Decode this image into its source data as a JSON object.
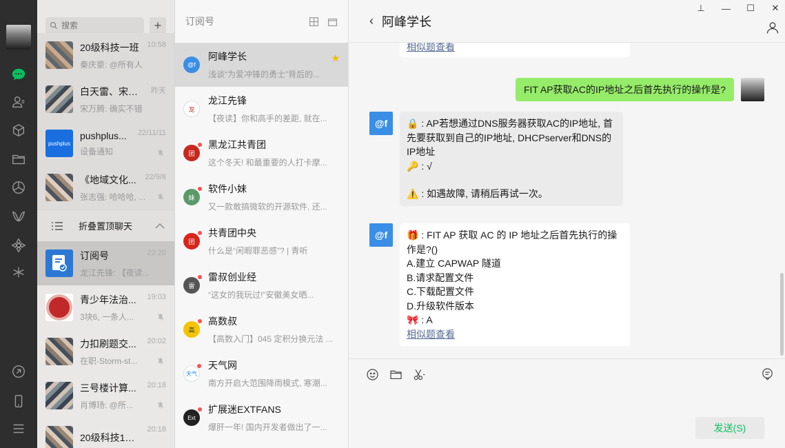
{
  "search": {
    "placeholder": "搜索"
  },
  "chats": [
    {
      "title": "20级科技一班",
      "sub": "秦庆豪: @所有人",
      "time": "10:58",
      "muted": false,
      "avatar_color": "#8b7b6a"
    },
    {
      "title": "白天雷、宋万...",
      "sub": "宋万腾: 确实不错",
      "time": "昨天",
      "muted": false,
      "avatar_color": "#7d8a8f"
    },
    {
      "title": "pushplus...",
      "sub": "设备通知",
      "time": "22/11/11",
      "muted": true,
      "avatar_color": "#1a6fe0"
    },
    {
      "title": "《地域文化...",
      "sub": "张志强: 哈哈哈, ...",
      "time": "22/9/8",
      "muted": true,
      "avatar_color": "#a08a7a"
    }
  ],
  "fold": {
    "label": "折叠置顶聊天"
  },
  "chats2": [
    {
      "title": "订阅号",
      "sub": "龙江先锋: 【夜读...",
      "time": "22:20",
      "muted": false,
      "avatar_color": "#2b78d4"
    },
    {
      "title": "青少年法治...",
      "sub": "3块6, 一条人...",
      "time": "19:03",
      "muted": true,
      "avatar_color": "#c0282a"
    },
    {
      "title": "力扣刷题交...",
      "sub": "在职-Storm-st...",
      "time": "20:02",
      "muted": true,
      "avatar_color": "#8a7c6f"
    },
    {
      "title": "三号楼计算...",
      "sub": "肖博玚: @所...",
      "time": "20:18",
      "muted": true,
      "avatar_color": "#7c8b91"
    },
    {
      "title": "20级科技1班...",
      "sub": "",
      "time": "20:18",
      "muted": false,
      "avatar_color": "#9a8574"
    }
  ],
  "pushplus_avatar_text": "pushplus",
  "sub_header": {
    "title": "订阅号"
  },
  "subs": [
    {
      "title": "阿峰学长",
      "sub": "浅谈“为爱冲锋的勇士”背后的...",
      "avatar_text": "@f",
      "avatar_color": "#3a8ee6",
      "starred": true,
      "dot": false
    },
    {
      "title": "龙江先锋",
      "sub": "【夜读】你和高手的差距, 就在...",
      "avatar_text": "龙",
      "avatar_color": "#b5322a",
      "starred": false,
      "dot": false
    },
    {
      "title": "黑龙江共青团",
      "sub": "这个冬天! 和最重要的人打卡摩...",
      "avatar_text": "团",
      "avatar_color": "#c8281e",
      "starred": false,
      "dot": true
    },
    {
      "title": "软件小妹",
      "sub": "又一款敢搞微软的开源软件, 还...",
      "avatar_text": "妹",
      "avatar_color": "#5a9a6a",
      "starred": false,
      "dot": true
    },
    {
      "title": "共青团中央",
      "sub": "什么是“闲暇罪恶感”? | 青听",
      "avatar_text": "团",
      "avatar_color": "#d9261c",
      "starred": false,
      "dot": true
    },
    {
      "title": "雷叔创业经",
      "sub": "“这女的我玩过!”安徽美女晒...",
      "avatar_text": "雷",
      "avatar_color": "#555555",
      "starred": false,
      "dot": true
    },
    {
      "title": "高数叔",
      "sub": "【高数入门】045 定积分换元法 ...",
      "avatar_text": "高",
      "avatar_color": "#f5c400",
      "starred": false,
      "dot": true
    },
    {
      "title": "天气网",
      "sub": "南方开启大范围降雨模式, 寒潮...",
      "avatar_text": "天气",
      "avatar_color": "#1e88e5",
      "starred": false,
      "dot": true
    },
    {
      "title": "扩展迷EXTFANS",
      "sub": "爆肝一年! 国内开发者做出了一...",
      "avatar_text": "Ext",
      "avatar_color": "#222222",
      "starred": false,
      "dot": true
    }
  ],
  "conversation": {
    "name": "阿峰学长",
    "back_glyph": "‹",
    "bot_avatar": "@f",
    "top_link": "相似题查看",
    "my_question": "FIT AP获取AC的IP地址之后首先执行的操作是?",
    "answer1": {
      "lock": "🔒",
      "text": "AP若想通过DNS服务器获取AC的IP地址, 首先要获取到自己的IP地址, DHCPserver和DNS的IP地址",
      "key": "🔑",
      "key_text": ": √",
      "warn": "⚠️",
      "warn_text": ": 如遇故障, 请稍后再试一次。"
    },
    "answer2": {
      "gift": "🎁",
      "question": ": FIT AP 获取 AC 的 IP 地址之后首先执行的操作是?()",
      "opt_a": "A.建立 CAPWAP 隧道",
      "opt_b": "B.请求配置文件",
      "opt_c": "C.下载配置文件",
      "opt_d": "D.升级软件版本",
      "bow": "🎀",
      "answer": ": A",
      "link": "相似题查看"
    }
  },
  "composer": {
    "send_label": "发送(S)"
  },
  "window": {
    "pin": "⊥",
    "min": "—",
    "max": "☐",
    "close": "✕"
  }
}
